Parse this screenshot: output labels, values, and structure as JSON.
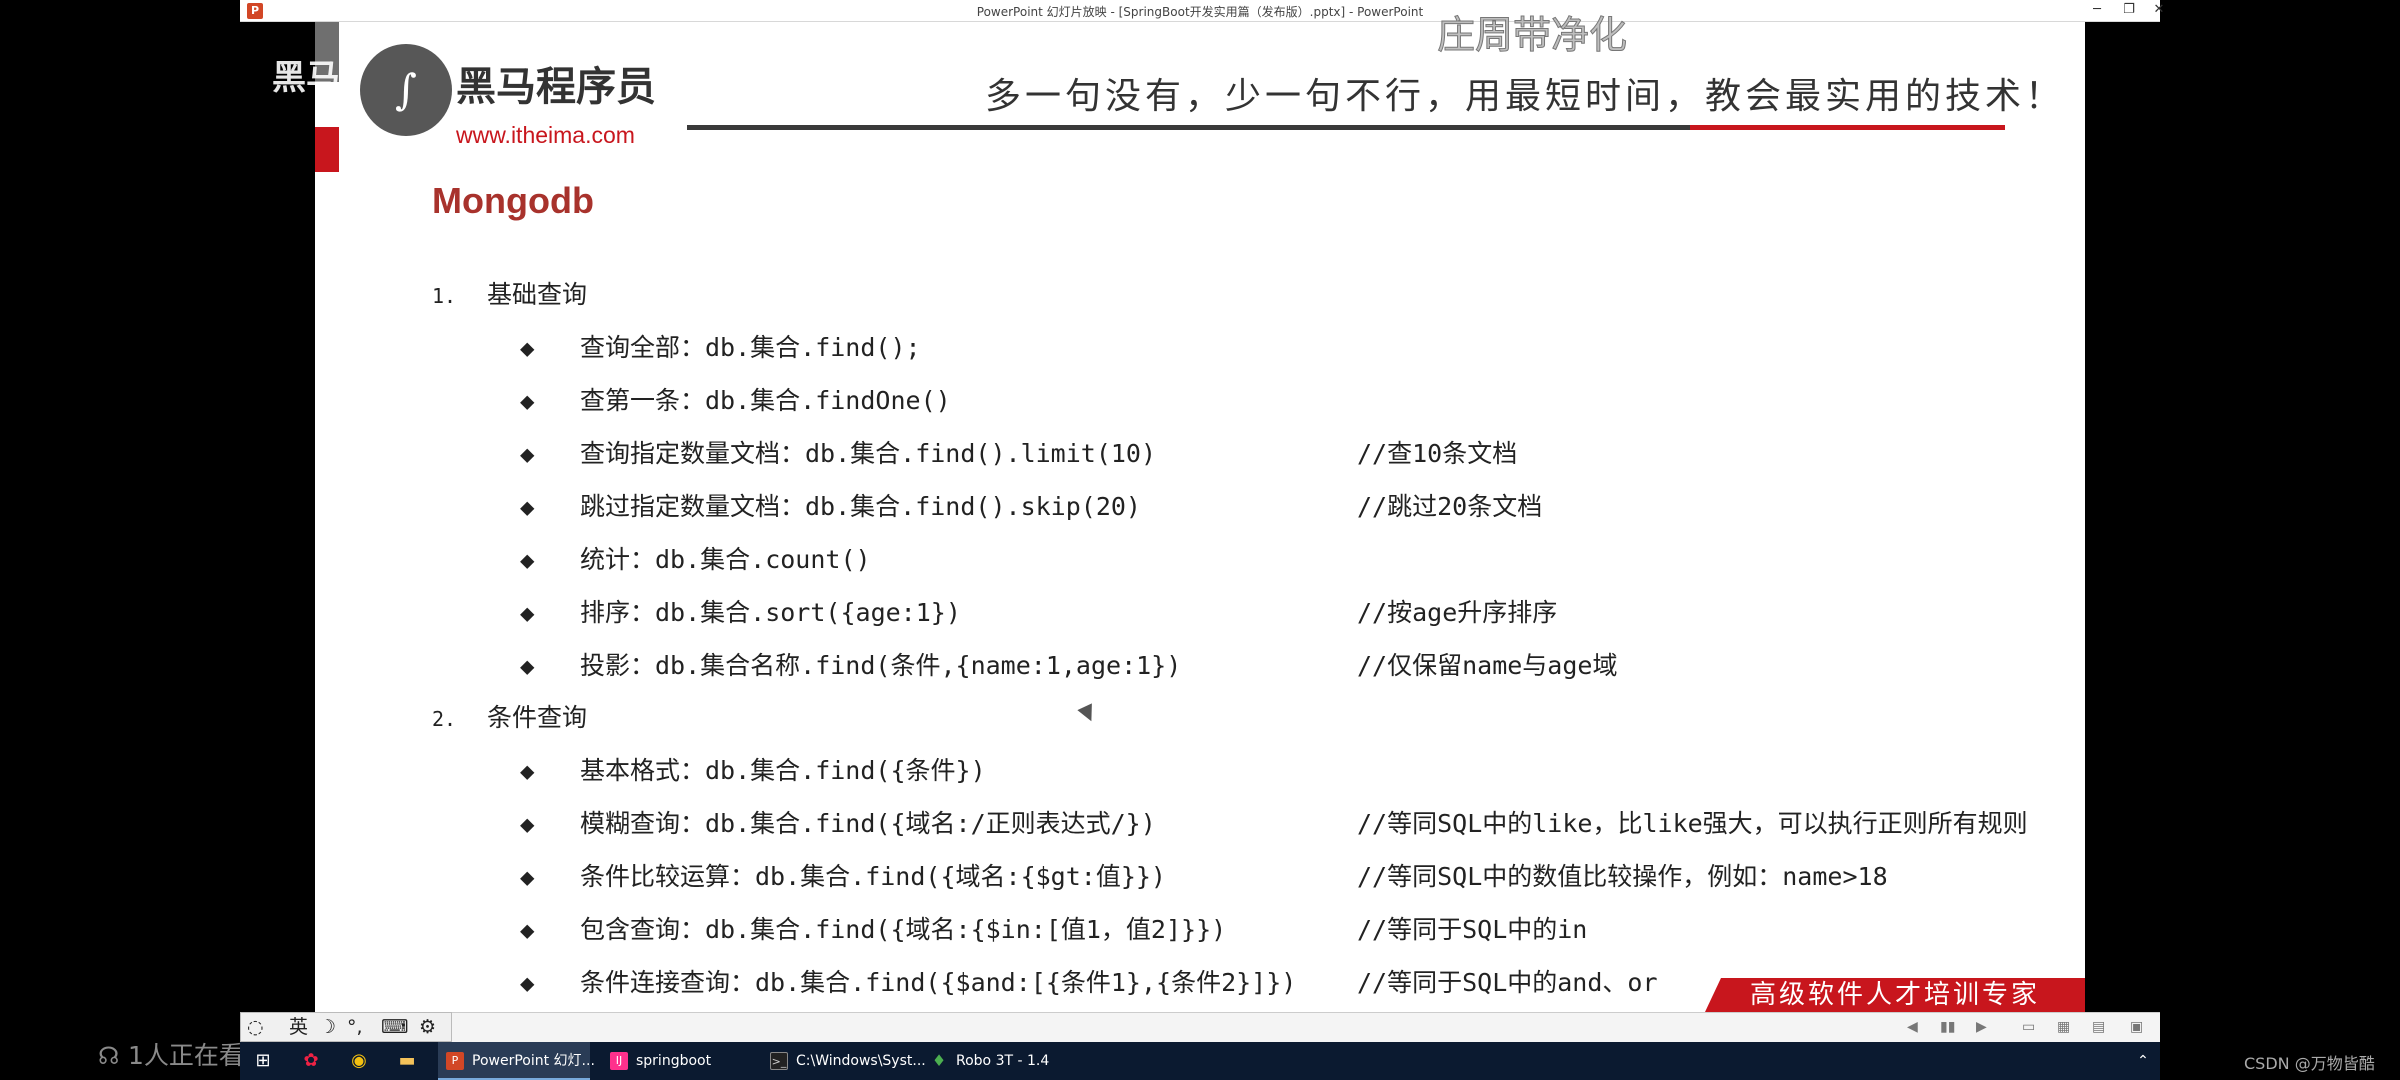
{
  "window": {
    "title": "PowerPoint 幻灯片放映 - [SpringBoot开发实用篇（发布版）.pptx] - PowerPoint",
    "minimize": "─",
    "restore": "❐",
    "close": "✕"
  },
  "slide": {
    "brand_name": "黑马程序员",
    "brand_url": "www.itheima.com",
    "slogan": "多一句没有，少一句不行，用最短时间，教会最实用的技术！",
    "title": "Mongodb",
    "sections": [
      {
        "number": "1.",
        "label": "基础查询",
        "items": [
          {
            "text": "查询全部：db.集合.find();",
            "comment": ""
          },
          {
            "text": "查第一条：db.集合.findOne()",
            "comment": ""
          },
          {
            "text": "查询指定数量文档：db.集合.find().limit(10)",
            "comment": "//查10条文档"
          },
          {
            "text": "跳过指定数量文档：db.集合.find().skip(20)",
            "comment": "//跳过20条文档"
          },
          {
            "text": "统计：db.集合.count()",
            "comment": ""
          },
          {
            "text": "排序：db.集合.sort({age:1})",
            "comment": "//按age升序排序"
          },
          {
            "text": "投影：db.集合名称.find(条件,{name:1,age:1})",
            "comment": "//仅保留name与age域"
          }
        ]
      },
      {
        "number": "2.",
        "label": "条件查询",
        "items": [
          {
            "text": "基本格式：db.集合.find({条件})",
            "comment": ""
          },
          {
            "text": "模糊查询：db.集合.find({域名:/正则表达式/})",
            "comment": "//等同SQL中的like，比like强大，可以执行正则所有规则"
          },
          {
            "text": "条件比较运算：db.集合.find({域名:{$gt:值}})",
            "comment": "//等同SQL中的数值比较操作，例如：name>18"
          },
          {
            "text": "包含查询：db.集合.find({域名:{$in:[值1，值2]}})",
            "comment": "//等同于SQL中的in"
          },
          {
            "text": "条件连接查询：db.集合.find({$and:[{条件1},{条件2}]})",
            "comment": "//等同于SQL中的and、or"
          }
        ]
      }
    ],
    "bullet": "◆",
    "footer_banner": "高级软件人才培训专家"
  },
  "overlays": {
    "watermark": "庄周带净化",
    "channel_text": "黑马",
    "viewers": "1人正在看",
    "credit": "CSDN @万物皆酷"
  },
  "ime": {
    "lang": "英",
    "moon": "☽",
    "punct": "°,",
    "keyboard": "⌨",
    "settings": "⚙"
  },
  "taskbar": {
    "start_icon": "windows-icon",
    "tasks": [
      {
        "label": "PowerPoint 幻灯...",
        "active": true
      },
      {
        "label": "springboot",
        "active": false
      },
      {
        "label": "C:\\Windows\\Syst...",
        "active": false
      },
      {
        "label": "Robo 3T - 1.4",
        "active": false
      }
    ],
    "tray_arrow": "⌃"
  }
}
